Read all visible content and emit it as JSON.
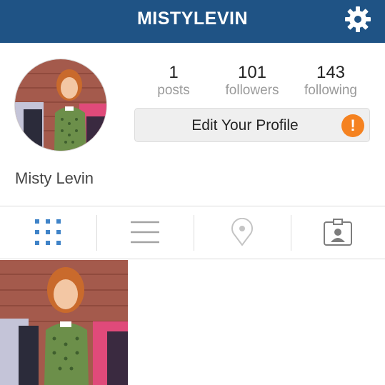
{
  "header": {
    "username": "MISTYLEVIN",
    "settings_icon": "gear-icon",
    "background_color": "#1f5385"
  },
  "profile": {
    "stats": [
      {
        "count": "1",
        "label": "posts"
      },
      {
        "count": "101",
        "label": "followers"
      },
      {
        "count": "143",
        "label": "following"
      }
    ],
    "edit_button_label": "Edit Your Profile",
    "warning_symbol": "!",
    "warning_color": "#f58220",
    "display_name": "Misty Levin"
  },
  "tabs": [
    {
      "name": "grid",
      "icon": "grid-icon",
      "active": true,
      "active_color": "#3f83c8"
    },
    {
      "name": "list",
      "icon": "list-icon",
      "active": false
    },
    {
      "name": "location",
      "icon": "location-pin-icon",
      "active": false
    },
    {
      "name": "tagged",
      "icon": "tagged-photos-icon",
      "active": false
    }
  ],
  "posts": [
    {
      "type": "image",
      "description_icon": "cartoon-woman-photo"
    }
  ]
}
